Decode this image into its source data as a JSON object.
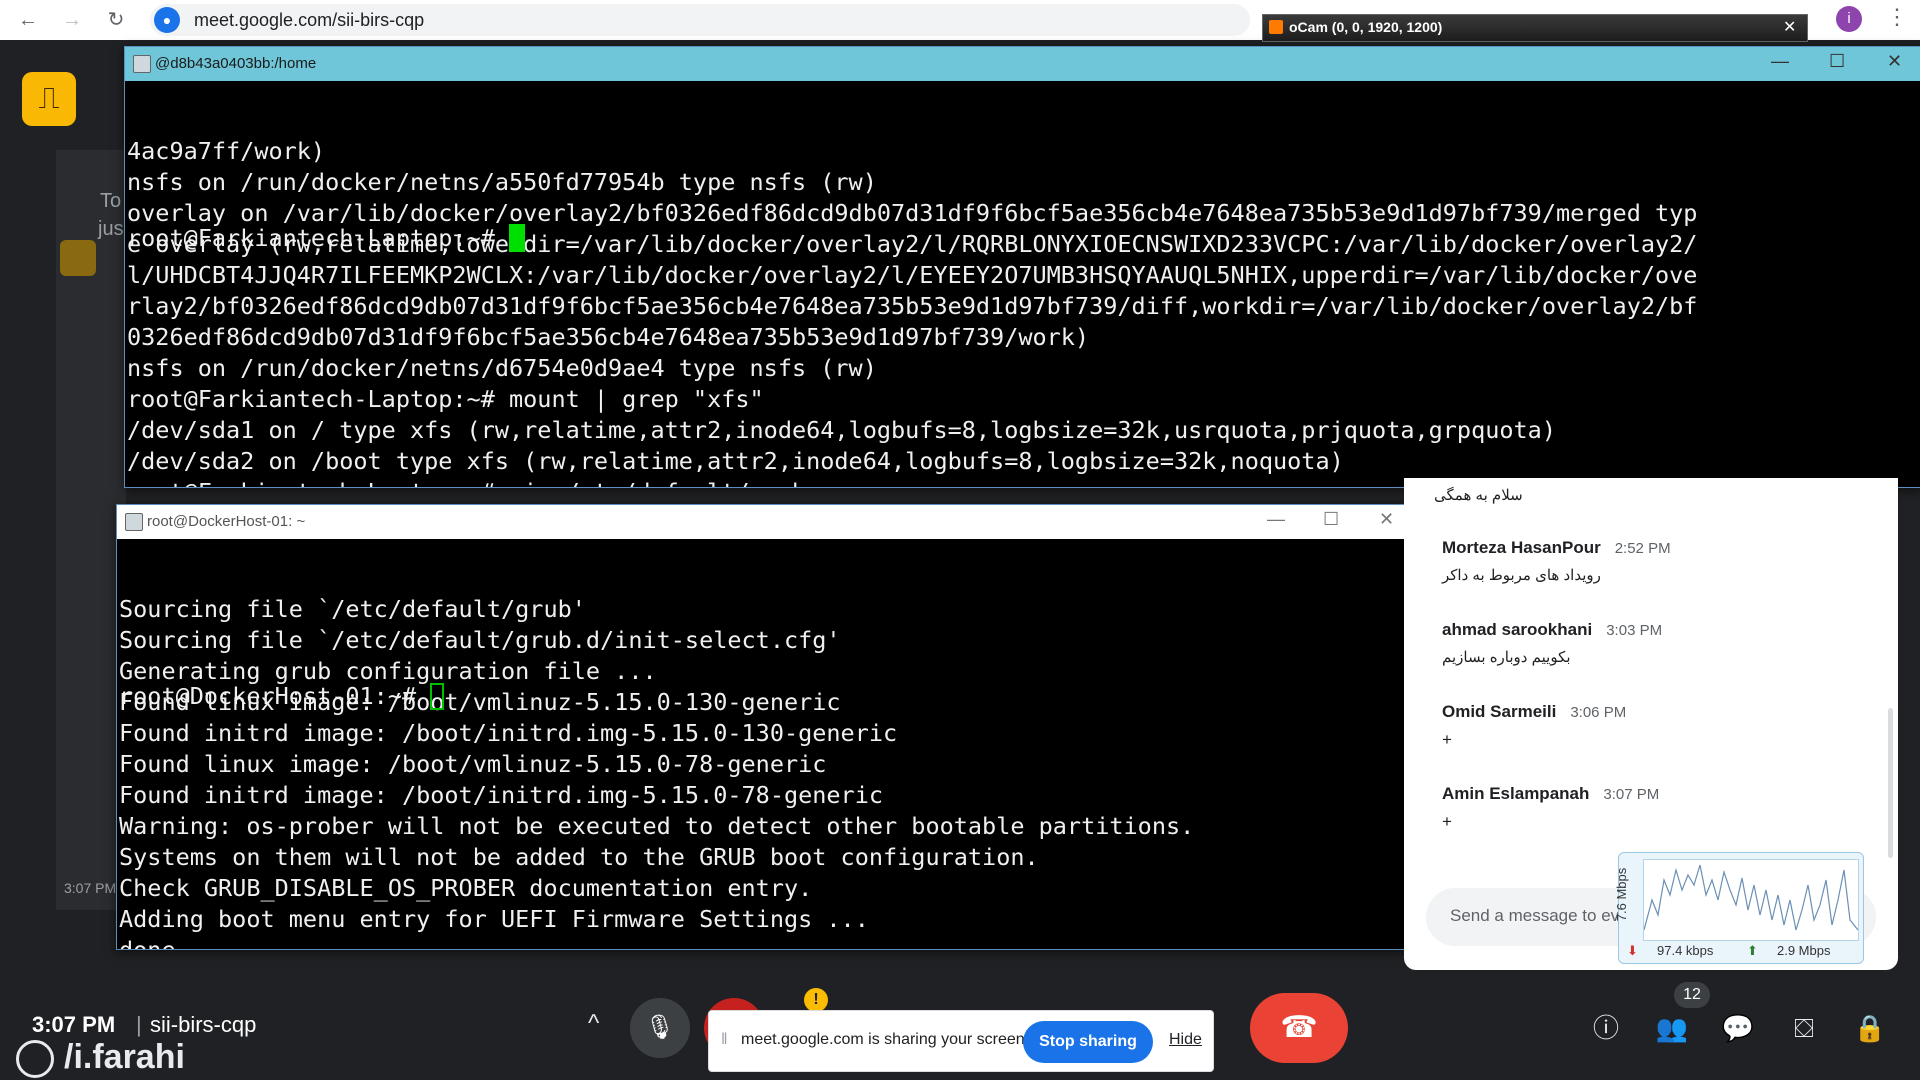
{
  "browser": {
    "url": "meet.google.com/sii-birs-cqp",
    "profile_initial": "i"
  },
  "ocam": {
    "title": "oCam (0, 0, 1920, 1200)"
  },
  "background": {
    "ghost_to": "To",
    "ghost_jus": "jus",
    "ghost_time": "3:07 PM"
  },
  "terminal_top": {
    "title": "@d8b43a0403bb:/home",
    "lines": [
      "4ac9a7ff/work)",
      "nsfs on /run/docker/netns/a550fd77954b type nsfs (rw)",
      "overlay on /var/lib/docker/overlay2/bf0326edf86dcd9db07d31df9f6bcf5ae356cb4e7648ea735b53e9d1d97bf739/merged typ",
      "e overlay (rw,relatime,lowerdir=/var/lib/docker/overlay2/l/RQRBLONYXIOECNSWIXD233VCPC:/var/lib/docker/overlay2/",
      "l/UHDCBT4JJQ4R7ILFEEMKP2WCLX:/var/lib/docker/overlay2/l/EYEEY2O7UMB3HSQYAAUQL5NHIX,upperdir=/var/lib/docker/ove",
      "rlay2/bf0326edf86dcd9db07d31df9f6bcf5ae356cb4e7648ea735b53e9d1d97bf739/diff,workdir=/var/lib/docker/overlay2/bf",
      "0326edf86dcd9db07d31df9f6bcf5ae356cb4e7648ea735b53e9d1d97bf739/work)",
      "nsfs on /run/docker/netns/d6754e0d9ae4 type nsfs (rw)",
      "root@Farkiantech-Laptop:~# mount | grep \"xfs\"",
      "/dev/sda1 on / type xfs (rw,relatime,attr2,inode64,logbufs=8,logbsize=32k,usrquota,prjquota,grpquota)",
      "/dev/sda2 on /boot type xfs (rw,relatime,attr2,inode64,logbufs=8,logbsize=32k,noquota)",
      "root@Farkiantech-Laptop:~# vim /etc/default/grub"
    ],
    "prompt": "root@Farkiantech-Laptop:~# "
  },
  "terminal_bottom": {
    "title": "root@DockerHost-01: ~",
    "lines": [
      "Sourcing file `/etc/default/grub'",
      "Sourcing file `/etc/default/grub.d/init-select.cfg'",
      "Generating grub configuration file ...",
      "Found linux image: /boot/vmlinuz-5.15.0-130-generic",
      "Found initrd image: /boot/initrd.img-5.15.0-130-generic",
      "Found linux image: /boot/vmlinuz-5.15.0-78-generic",
      "Found initrd image: /boot/initrd.img-5.15.0-78-generic",
      "Warning: os-prober will not be executed to detect other bootable partitions.",
      "Systems on them will not be added to the GRUB boot configuration.",
      "Check GRUB_DISABLE_OS_PROBER documentation entry.",
      "Adding boot menu entry for UEFI Firmware Settings ...",
      "done"
    ],
    "prompt": "root@DockerHost-01:~# "
  },
  "chat": {
    "top_message": "سلام به همگی",
    "messages": [
      {
        "name": "Morteza HasanPour",
        "time": "2:52 PM",
        "text": "رویداد های مربوط به داکر"
      },
      {
        "name": "ahmad sarookhani",
        "time": "3:03 PM",
        "text": "بکوییم دوباره بسازیم"
      },
      {
        "name": "Omid Sarmeili",
        "time": "3:06 PM",
        "text": "+"
      },
      {
        "name": "Amin Eslampanah",
        "time": "3:07 PM",
        "text": "+"
      }
    ],
    "input_placeholder": "Send a message to everyone"
  },
  "bandwidth": {
    "scale": "7.6 Mbps",
    "down": "97.4 kbps",
    "up": "2.9 Mbps"
  },
  "bottom_bar": {
    "time": "3:07 PM",
    "meeting_code": "sii-birs-cqp",
    "participants_count": "12",
    "watermark_user": "/i.farahi",
    "share_text": "meet.google.com is sharing your screen.",
    "stop_sharing": "Stop sharing",
    "hide": "Hide"
  }
}
